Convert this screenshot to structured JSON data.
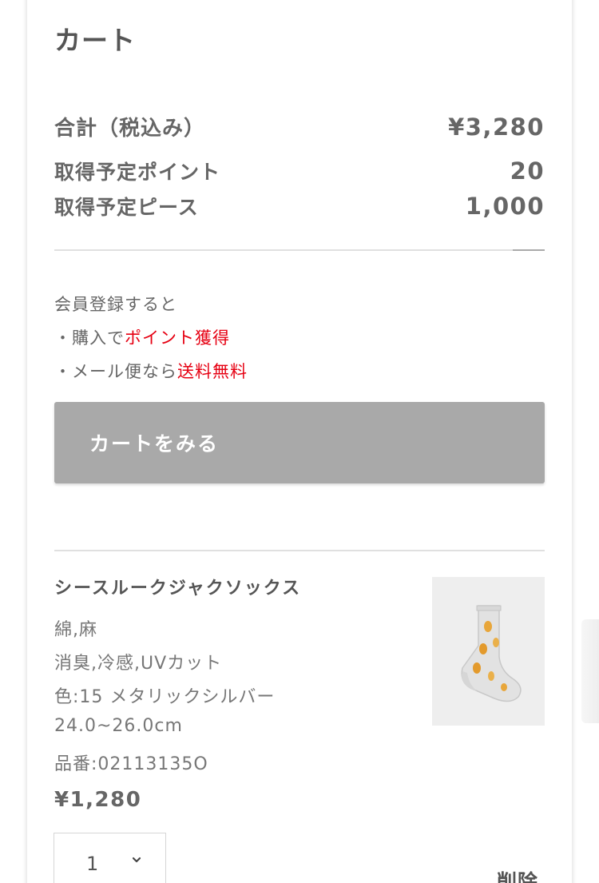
{
  "cart": {
    "title": "カート",
    "summary": {
      "total_label": "合計（税込み）",
      "total_value": "¥3,280",
      "points_label": "取得予定ポイント",
      "points_value": "20",
      "pieces_label": "取得予定ピース",
      "pieces_value": "1,000"
    },
    "member_note": {
      "heading": "会員登録すると",
      "line1_prefix": "・購入で",
      "line1_highlight": "ポイント獲得",
      "line2_prefix": "・メール便なら",
      "line2_highlight": "送料無料"
    },
    "view_cart_button": "カートをみる",
    "item": {
      "name": "シースルークジャクソックス",
      "material": "綿,麻",
      "features": "消臭,冷感,UVカット",
      "color": "色:15 メタリックシルバー",
      "size": "24.0~26.0cm",
      "product_code": "品番:02113135O",
      "price": "¥1,280",
      "quantity": "1",
      "delete_label": "削除",
      "image_icon": "socks-product-icon"
    }
  },
  "colors": {
    "accent_red": "#e60012",
    "button_gray": "#a9a9a9",
    "text_gray": "#666666"
  }
}
